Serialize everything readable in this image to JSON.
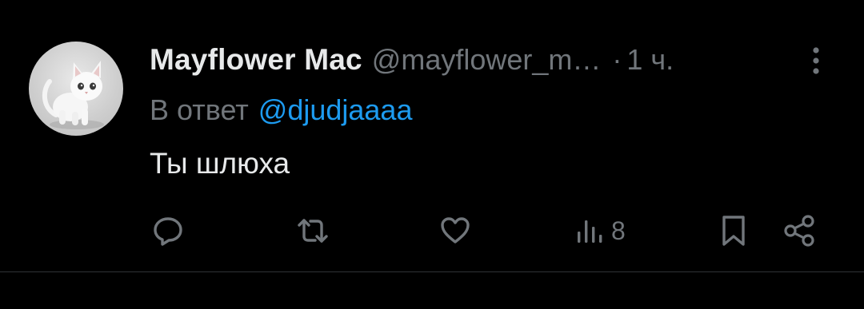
{
  "tweet": {
    "display_name": "Mayflower Mac",
    "handle": "@mayflower_m…",
    "separator": "·",
    "time": "1 ч.",
    "reply_prefix": "В ответ",
    "reply_to": "@djudjaaaa",
    "text": "Ты шлюха",
    "views": "8"
  },
  "icons": {
    "avatar": "white-kitten-avatar",
    "more": "more-vertical-icon",
    "reply": "reply-icon",
    "repost": "repost-icon",
    "like": "heart-icon",
    "views": "views-icon",
    "bookmark": "bookmark-icon",
    "share": "share-icon"
  },
  "colors": {
    "background": "#000000",
    "primary_text": "#e7e9ea",
    "secondary_text": "#71767b",
    "link": "#1d9bf0",
    "divider": "#2f3336"
  }
}
